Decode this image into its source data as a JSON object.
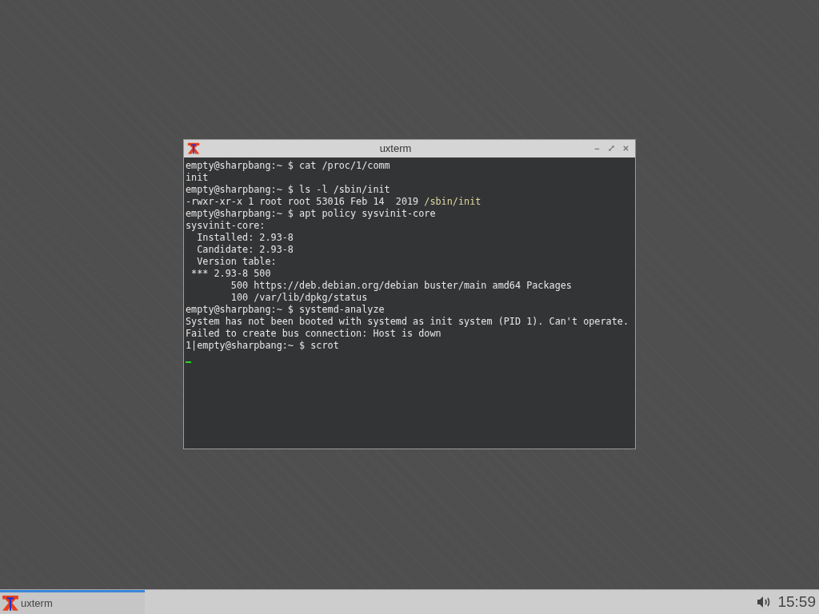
{
  "window": {
    "title": "uxterm",
    "lines": [
      [
        {
          "kind": "plain",
          "text": "empty@sharpbang:~ $ cat /proc/1/comm"
        }
      ],
      [
        {
          "kind": "plain",
          "text": "init"
        }
      ],
      [
        {
          "kind": "plain",
          "text": "empty@sharpbang:~ $ ls -l /sbin/init"
        }
      ],
      [
        {
          "kind": "plain",
          "text": "-rwxr-xr-x 1 root root 53016 Feb 14  2019 "
        },
        {
          "kind": "path",
          "text": "/sbin/init"
        }
      ],
      [
        {
          "kind": "plain",
          "text": "empty@sharpbang:~ $ apt policy sysvinit-core"
        }
      ],
      [
        {
          "kind": "plain",
          "text": "sysvinit-core:"
        }
      ],
      [
        {
          "kind": "plain",
          "text": "  Installed: 2.93-8"
        }
      ],
      [
        {
          "kind": "plain",
          "text": "  Candidate: 2.93-8"
        }
      ],
      [
        {
          "kind": "plain",
          "text": "  Version table:"
        }
      ],
      [
        {
          "kind": "plain",
          "text": " *** 2.93-8 500"
        }
      ],
      [
        {
          "kind": "plain",
          "text": "        500 https://deb.debian.org/debian buster/main amd64 Packages"
        }
      ],
      [
        {
          "kind": "plain",
          "text": "        100 /var/lib/dpkg/status"
        }
      ],
      [
        {
          "kind": "plain",
          "text": "empty@sharpbang:~ $ systemd-analyze"
        }
      ],
      [
        {
          "kind": "plain",
          "text": "System has not been booted with systemd as init system (PID 1). Can't operate."
        }
      ],
      [
        {
          "kind": "plain",
          "text": "Failed to create bus connection: Host is down"
        }
      ],
      [
        {
          "kind": "plain",
          "text": "1|empty@sharpbang:~ $ scrot"
        }
      ]
    ]
  },
  "taskbar": {
    "tasks": [
      {
        "label": "uxterm",
        "selected": true
      }
    ],
    "clock": "15:59"
  }
}
